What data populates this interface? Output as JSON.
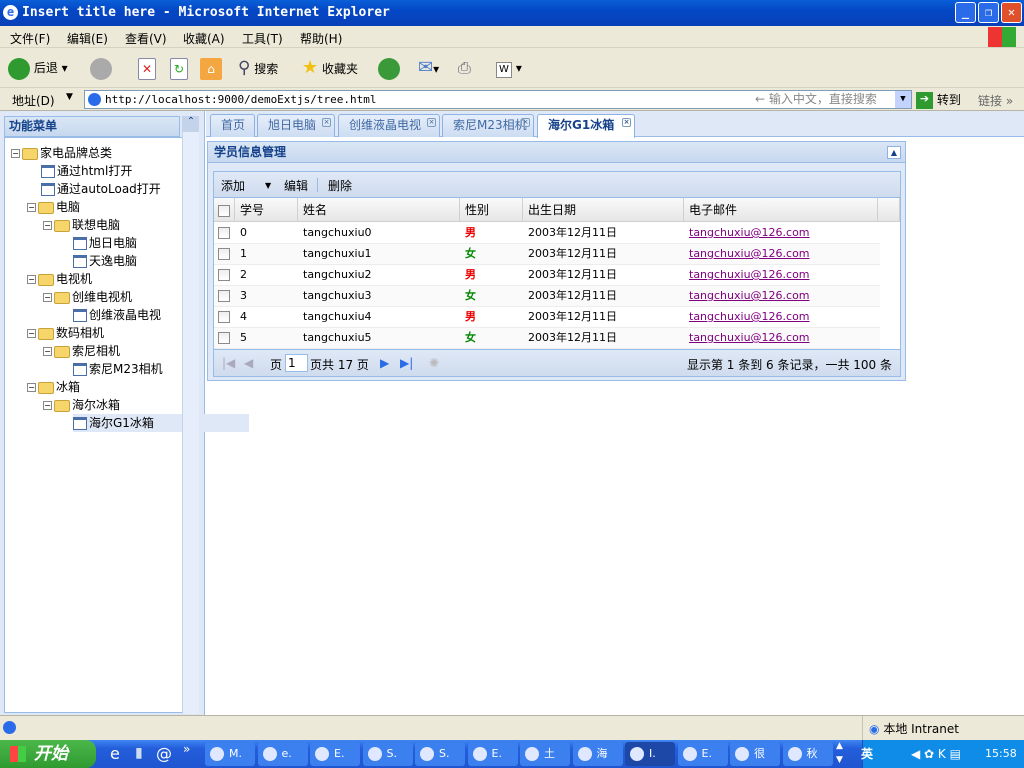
{
  "window": {
    "title": "Insert title here - Microsoft Internet Explorer"
  },
  "menu": [
    "文件(F)",
    "编辑(E)",
    "查看(V)",
    "收藏(A)",
    "工具(T)",
    "帮助(H)"
  ],
  "toolbar": {
    "back": "后退",
    "search": "搜索",
    "favorites": "收藏夹"
  },
  "address": {
    "label": "地址(D)",
    "url": "http://localhost:9000/demoExtjs/tree.html",
    "search_placeholder": "输入中文，直接搜索",
    "go": "转到",
    "links": "链接"
  },
  "sidebar": {
    "title": "功能菜单",
    "nodes": [
      {
        "label": "家电品牌总类",
        "level": 0,
        "type": "folder"
      },
      {
        "label": "通过html打开",
        "level": 1,
        "type": "leaf"
      },
      {
        "label": "通过autoLoad打开",
        "level": 1,
        "type": "leaf"
      },
      {
        "label": "电脑",
        "level": 1,
        "type": "folder"
      },
      {
        "label": "联想电脑",
        "level": 2,
        "type": "folder"
      },
      {
        "label": "旭日电脑",
        "level": 3,
        "type": "leaf"
      },
      {
        "label": "天逸电脑",
        "level": 3,
        "type": "leaf"
      },
      {
        "label": "电视机",
        "level": 1,
        "type": "folder"
      },
      {
        "label": "创维电视机",
        "level": 2,
        "type": "folder"
      },
      {
        "label": "创维液晶电视",
        "level": 3,
        "type": "leaf"
      },
      {
        "label": "数码相机",
        "level": 1,
        "type": "folder"
      },
      {
        "label": "索尼相机",
        "level": 2,
        "type": "folder"
      },
      {
        "label": "索尼M23相机",
        "level": 3,
        "type": "leaf"
      },
      {
        "label": "冰箱",
        "level": 1,
        "type": "folder"
      },
      {
        "label": "海尔冰箱",
        "level": 2,
        "type": "folder"
      },
      {
        "label": "海尔G1冰箱",
        "level": 3,
        "type": "leaf",
        "selected": true
      }
    ]
  },
  "tabs": [
    {
      "label": "首页",
      "closable": false
    },
    {
      "label": "旭日电脑",
      "closable": true
    },
    {
      "label": "创维液晶电视",
      "closable": true
    },
    {
      "label": "索尼M23相机",
      "closable": true
    },
    {
      "label": "海尔G1冰箱",
      "closable": true,
      "active": true
    }
  ],
  "panel": {
    "title": "学员信息管理"
  },
  "grid": {
    "toolbar": {
      "add": "添加",
      "edit": "编辑",
      "delete": "删除"
    },
    "columns": [
      "学号",
      "姓名",
      "性别",
      "出生日期",
      "电子邮件"
    ],
    "rows": [
      {
        "id": "0",
        "name": "tangchuxiu0",
        "gender": "男",
        "birth": "2003年12月11日",
        "email": "tangchuxiu@126.com"
      },
      {
        "id": "1",
        "name": "tangchuxiu1",
        "gender": "女",
        "birth": "2003年12月11日",
        "email": "tangchuxiu@126.com"
      },
      {
        "id": "2",
        "name": "tangchuxiu2",
        "gender": "男",
        "birth": "2003年12月11日",
        "email": "tangchuxiu@126.com"
      },
      {
        "id": "3",
        "name": "tangchuxiu3",
        "gender": "女",
        "birth": "2003年12月11日",
        "email": "tangchuxiu@126.com"
      },
      {
        "id": "4",
        "name": "tangchuxiu4",
        "gender": "男",
        "birth": "2003年12月11日",
        "email": "tangchuxiu@126.com"
      },
      {
        "id": "5",
        "name": "tangchuxiu5",
        "gender": "女",
        "birth": "2003年12月11日",
        "email": "tangchuxiu@126.com"
      }
    ],
    "pager": {
      "page_label": "页",
      "page": "1",
      "of_label": "页共 17 页",
      "summary": "显示第 1 条到 6 条记录，一共 100 条"
    }
  },
  "status": {
    "zone": "本地 Intranet"
  },
  "taskbar": {
    "start": "开始",
    "tasks": [
      "M.",
      "e.",
      "E.",
      "S.",
      "S.",
      "E.",
      "土",
      "海",
      "I.",
      "E.",
      "很",
      "秋"
    ],
    "active_task": 8,
    "clock": "15:58",
    "ime": "英"
  }
}
